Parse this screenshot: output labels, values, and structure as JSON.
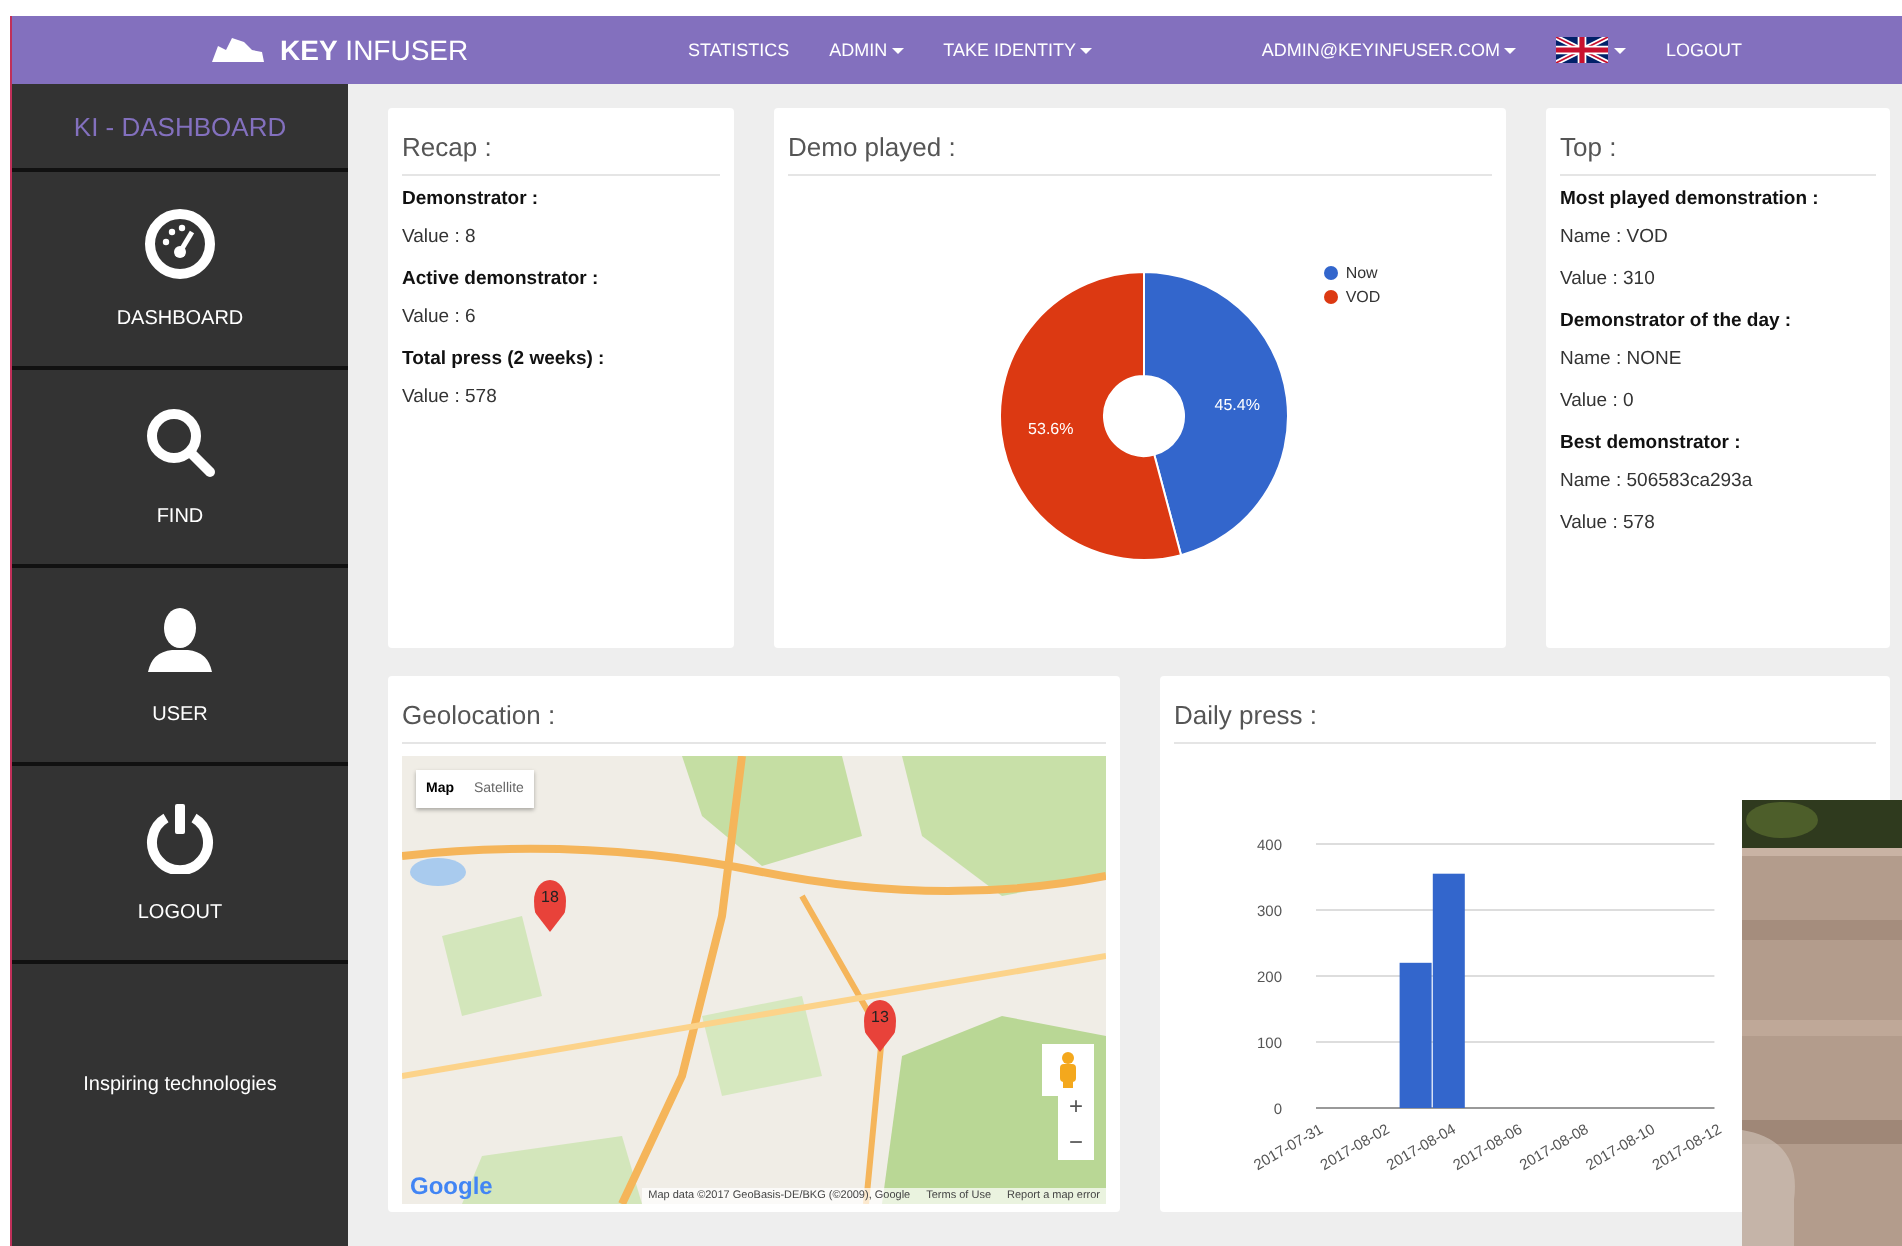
{
  "navbar": {
    "brand_bold": "KEY",
    "brand_rest": "INFUSER",
    "menu": [
      {
        "label": "STATISTICS",
        "dropdown": false
      },
      {
        "label": "ADMIN",
        "dropdown": true
      },
      {
        "label": "TAKE IDENTITY",
        "dropdown": true
      }
    ],
    "account": {
      "label": "ADMIN@KEYINFUSER.COM",
      "dropdown": true
    },
    "logout": "LOGOUT"
  },
  "sidebar": {
    "title": "KI - DASHBOARD",
    "items": [
      {
        "label": "DASHBOARD"
      },
      {
        "label": "FIND"
      },
      {
        "label": "USER"
      },
      {
        "label": "LOGOUT"
      }
    ],
    "tagline": "Inspiring technologies"
  },
  "recap": {
    "title": "Recap :",
    "entries": [
      {
        "label": "Demonstrator :",
        "value": "Value : 8"
      },
      {
        "label": "Active demonstrator :",
        "value": "Value : 6"
      },
      {
        "label": "Total press (2 weeks) :",
        "value": "Value : 578"
      }
    ]
  },
  "demo_played": {
    "title": "Demo played :",
    "chart_data": {
      "type": "donut",
      "categories": [
        "Now",
        "VOD"
      ],
      "values": [
        45.4,
        53.6
      ],
      "colors": [
        "#3366cc",
        "#dc3912"
      ],
      "data_labels": true,
      "value_labels": [
        "45.4%",
        "53.6%"
      ],
      "legend": true
    }
  },
  "top": {
    "title": "Top :",
    "entries": [
      {
        "label": "Most played demonstration :",
        "values": [
          "Name : VOD",
          "Value : 310"
        ]
      },
      {
        "label": "Demonstrator of the day :",
        "values": [
          "Name : NONE",
          "Value : 0"
        ]
      },
      {
        "label": "Best demonstrator :",
        "values": [
          "Name : 506583ca293a",
          "Value : 578"
        ]
      }
    ]
  },
  "geolocation": {
    "title": "Geolocation :",
    "map": {
      "kind": "picture",
      "map_type": [
        {
          "label": "Map",
          "selected": true
        },
        {
          "label": "Satellite",
          "selected": false
        }
      ],
      "markers": [
        {
          "label": "18"
        },
        {
          "label": "13"
        }
      ],
      "zoom_in": "+",
      "zoom_out": "−",
      "logo": "Google",
      "attribution": "Map data ©2017 GeoBasis-DE/BKG (©2009), Google",
      "terms": "Terms of Use",
      "report": "Report a map error"
    }
  },
  "daily_press": {
    "title": "Daily press :",
    "chart_data": {
      "type": "bar",
      "x": [
        "2017-07-31",
        "2017-08-01",
        "2017-08-02",
        "2017-08-03",
        "2017-08-04",
        "2017-08-05",
        "2017-08-06",
        "2017-08-07",
        "2017-08-08",
        "2017-08-09",
        "2017-08-10",
        "2017-08-11",
        "2017-08-12"
      ],
      "values": [
        0,
        0,
        0,
        220,
        355,
        0,
        0,
        0,
        0,
        0,
        0,
        0,
        0
      ],
      "xlim": [
        "2017-07-31",
        "2017-08-12"
      ],
      "ylim": [
        0,
        400
      ],
      "yticks": [
        0,
        100,
        200,
        300,
        400
      ],
      "xticks": [
        "2017-07-31",
        "2017-08-02",
        "2017-08-04",
        "2017-08-06",
        "2017-08-08",
        "2017-08-10",
        "2017-08-12"
      ],
      "grid": true
    }
  }
}
